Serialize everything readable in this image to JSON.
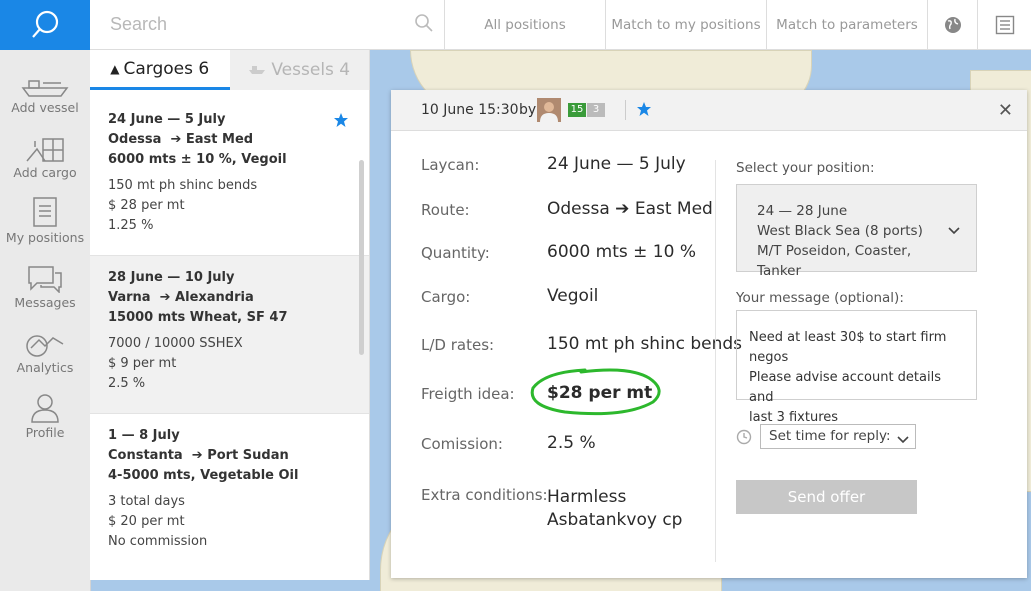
{
  "search": {
    "placeholder": "Search"
  },
  "topbar": {
    "all_positions": "All positions",
    "match_positions": "Match to my positions",
    "match_parameters": "Match to parameters"
  },
  "nav": {
    "items": [
      {
        "label": "Add vessel",
        "icon": "ship-icon"
      },
      {
        "label": "Add cargo",
        "icon": "cargo-icon"
      },
      {
        "label": "My positions",
        "icon": "document-icon"
      },
      {
        "label": "Messages",
        "icon": "messages-icon"
      },
      {
        "label": "Analytics",
        "icon": "analytics-icon"
      },
      {
        "label": "Profile",
        "icon": "profile-icon"
      }
    ]
  },
  "tabs": {
    "cargoes": "Cargoes 6",
    "vessels": "Vessels 4"
  },
  "cards": [
    {
      "dates": "24 June — 5 July",
      "route_from": "Odessa",
      "route_to": "East Med",
      "cargo": "6000 mts ± 10 %, Vegoil",
      "line1": "150 mt ph shinc bends",
      "line2": "$ 28 per mt",
      "line3": "1.25 %"
    },
    {
      "dates": "28 June — 10 July",
      "route_from": "Varna",
      "route_to": "Alexandria",
      "cargo": "15000 mts Wheat, SF 47",
      "line1": "7000 / 10000 SSHEX",
      "line2": "$ 9 per mt",
      "line3": "2.5 %"
    },
    {
      "dates": "1 — 8 July",
      "route_from": "Constanta",
      "route_to": "Port Sudan",
      "cargo": "4-5000 mts, Vegetable Oil",
      "line1": "3 total days",
      "line2": "$ 20 per mt",
      "line3": "No commission"
    }
  ],
  "dialog": {
    "date": "10 June 15:30",
    "by": "by",
    "badge1": "15",
    "badge2": "3",
    "labels": {
      "laycan": "Laycan:",
      "route": "Route:",
      "quantity": "Quantity:",
      "cargo": "Cargo:",
      "ld": "L/D rates:",
      "freight": "Freigth idea:",
      "commission": "Comission:",
      "extra": "Extra conditions:"
    },
    "values": {
      "laycan": "24 June — 5 July",
      "route_from": "Odessa",
      "route_to": "East Med",
      "quantity": "6000 mts ± 10 %",
      "cargo": "Vegoil",
      "ld": "150 mt ph shinc bends",
      "freight": "$28 per mt",
      "commission": "2.5 %",
      "extra1": "Harmless",
      "extra2": "Asbatankvoy cp"
    },
    "select_position_label": "Select your position:",
    "position": {
      "line1": "24 — 28 June",
      "line2": "West Black Sea (8 ports)",
      "line3": "M/T Poseidon, Coaster, Tanker"
    },
    "message_label": "Your message (optional):",
    "message": {
      "line1": "Need at least 30$ to start firm negos",
      "line2": "Please advise account details and",
      "line3": "last 3 fixtures"
    },
    "time_placeholder": "Set time for reply:",
    "send_label": "Send offer"
  },
  "colors": {
    "accent": "#1a87e6",
    "highlight": "#2db82d"
  }
}
